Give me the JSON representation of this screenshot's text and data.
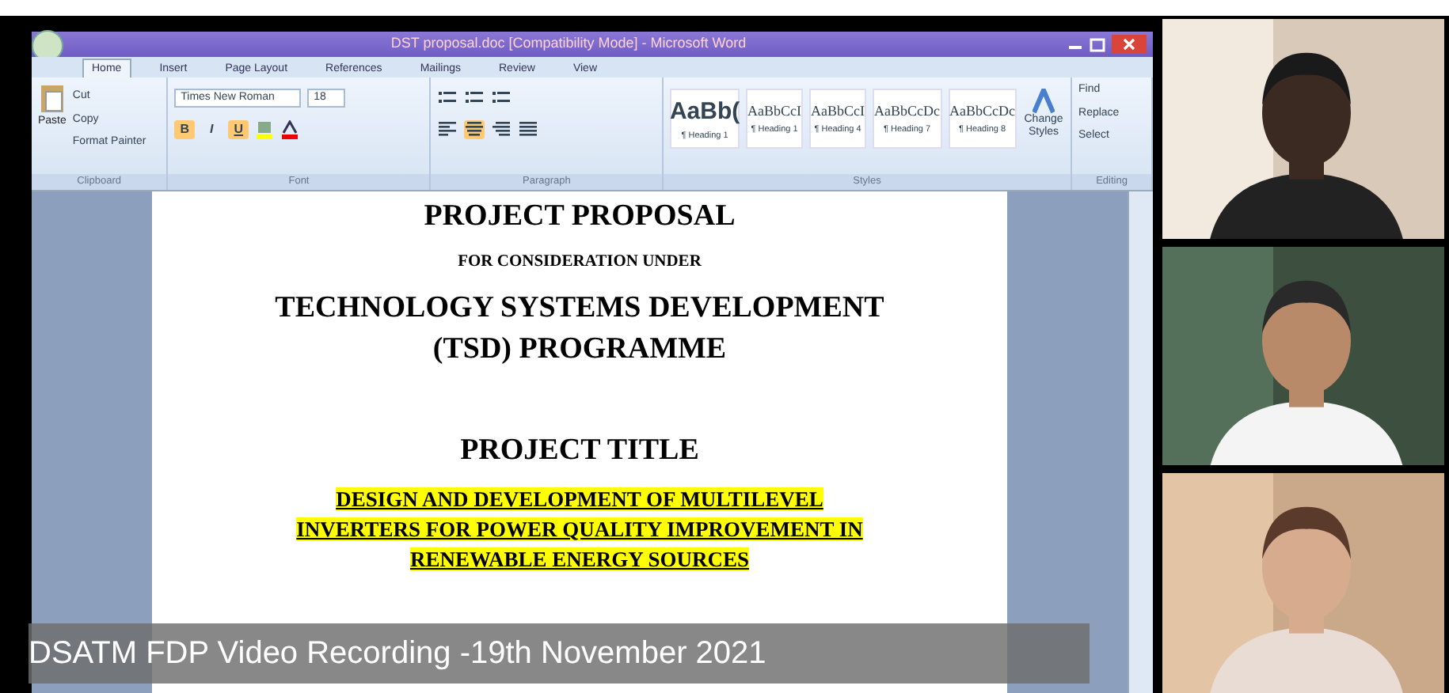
{
  "window": {
    "title": "DST proposal.doc [Compatibility Mode] - Microsoft Word"
  },
  "tabs": [
    {
      "label": "Home",
      "selected": true
    },
    {
      "label": "Insert",
      "selected": false
    },
    {
      "label": "Page Layout",
      "selected": false
    },
    {
      "label": "References",
      "selected": false
    },
    {
      "label": "Mailings",
      "selected": false
    },
    {
      "label": "Review",
      "selected": false
    },
    {
      "label": "View",
      "selected": false
    }
  ],
  "ribbon": {
    "clipboard": {
      "paste": "Paste",
      "items": [
        "Cut",
        "Copy",
        "Format Painter"
      ],
      "label": "Clipboard"
    },
    "font": {
      "family": "Times New Roman",
      "size": "18",
      "format_buttons": [
        {
          "label": "B",
          "selected": true
        },
        {
          "label": "I",
          "selected": false
        },
        {
          "label": "U",
          "selected": true
        }
      ],
      "label": "Font"
    },
    "paragraph": {
      "alignments": [
        {
          "kind": "left",
          "selected": false
        },
        {
          "kind": "center",
          "selected": true
        },
        {
          "kind": "right",
          "selected": false
        },
        {
          "kind": "justify",
          "selected": false
        }
      ],
      "label": "Paragraph"
    },
    "styles": {
      "items": [
        {
          "preview": "AaBb(",
          "name": "¶ Heading 1"
        },
        {
          "preview": "AaBbCcI",
          "name": "¶ Heading 1"
        },
        {
          "preview": "AaBbCcI",
          "name": "¶ Heading 4"
        },
        {
          "preview": "AaBbCcDc",
          "name": "¶ Heading 7"
        },
        {
          "preview": "AaBbCcDc",
          "name": "¶ Heading 8"
        }
      ],
      "change_styles": "Change Styles",
      "label": "Styles"
    },
    "editing": {
      "items": [
        "Find",
        "Replace",
        "Select"
      ],
      "label": "Editing"
    }
  },
  "document": {
    "lines": [
      {
        "text": "PROJECT PROPOSAL",
        "kind": "heading"
      },
      {
        "text": "FOR CONSIDERATION UNDER",
        "kind": "small"
      },
      {
        "text": "TECHNOLOGY SYSTEMS DEVELOPMENT",
        "kind": "heading"
      },
      {
        "text": "(TSD) PROGRAMME",
        "kind": "heading"
      },
      {
        "text": "PROJECT TITLE",
        "kind": "title"
      },
      {
        "text": "DESIGN AND DEVELOPMENT OF MULTILEVEL",
        "kind": "highlight"
      },
      {
        "text": "INVERTERS FOR POWER QUALITY IMPROVEMENT IN",
        "kind": "highlight"
      },
      {
        "text": "RENEWABLE ENERGY SOURCES",
        "kind": "highlight"
      }
    ]
  },
  "caption": "DSATM FDP Video Recording -19th November 2021"
}
